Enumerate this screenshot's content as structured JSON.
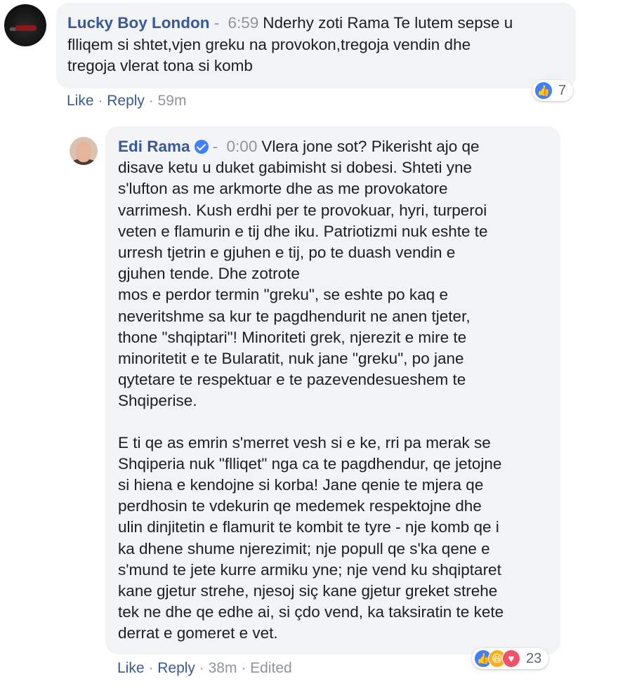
{
  "comments": [
    {
      "author": "Lucky Boy London",
      "time": "6:59",
      "text": "Nderhy zoti Rama Te lutem sepse u\nflliqem si shtet,vjen greku na provokon,tregoja vendin dhe\ntregoja vlerat tona si komb",
      "actions": {
        "like": "Like",
        "reply": "Reply",
        "age": "59m",
        "separator": "·"
      },
      "reactions": {
        "count": "7",
        "icons": [
          "like-icon"
        ]
      },
      "avatar_icon": "profile-photo-car"
    },
    {
      "author": "Edi Rama",
      "verified": true,
      "time": "0:00",
      "text_p1": "Vlera jone sot? Pikerisht ajo qe\ndisave ketu u duket gabimisht si dobesi. Shteti yne\ns'lufton as me arkmorte dhe as me provokatore\nvarrimesh. Kush erdhi per te provokuar, hyri, turperoi\nveten e flamurin e tij dhe iku. Patriotizmi nuk eshte te\nurresh tjetrin e gjuhen e tij, po te duash vendin e\ngjuhen tende. Dhe zotrote\nmos e perdor termin \"greku\", se eshte po kaq e\nneveritshme sa kur te pagdhendurit ne anen tjeter,\nthone \"shqiptari\"! Minoriteti grek, njerezit e mire te\nminoritetit e te Bularatit, nuk jane \"greku\", po jane\nqytetare te respektuar e te pazevendesueshem te\nShqiperise.",
      "text_p2": "E ti qe as emrin s'merret vesh si e ke, rri pa merak se\nShqiperia nuk \"flliqet\" nga ca te pagdhendur, qe jetojne\nsi hiena e kendojne si korba! Jane qenie te mjera qe\nperdhosin te vdekurin qe medemek respektojne dhe\nulin dinjitetin e flamurit te kombit te tyre - nje komb qe i\nka dhene shume njerezimit; nje popull qe s'ka qene e\ns'mund te jete kurre armiku yne; nje vend ku shqiptaret\nkane gjetur strehe, njesoj siç kane gjetur greket strehe\ntek ne dhe qe edhe ai, si çdo vend, ka taksiratin te kete\nderrat e gomeret e vet.",
      "actions": {
        "like": "Like",
        "reply": "Reply",
        "age": "38m",
        "edited": "Edited",
        "separator": "·"
      },
      "reactions": {
        "count": "23",
        "icons": [
          "like-icon",
          "haha-icon",
          "love-icon"
        ]
      },
      "avatar_icon": "profile-photo-man"
    }
  ],
  "colors": {
    "author": "#385898",
    "bubble": "#f2f3f5",
    "meta": "#90949c",
    "like": "#4080ff",
    "haha": "#f7b125",
    "love": "#f25268"
  }
}
